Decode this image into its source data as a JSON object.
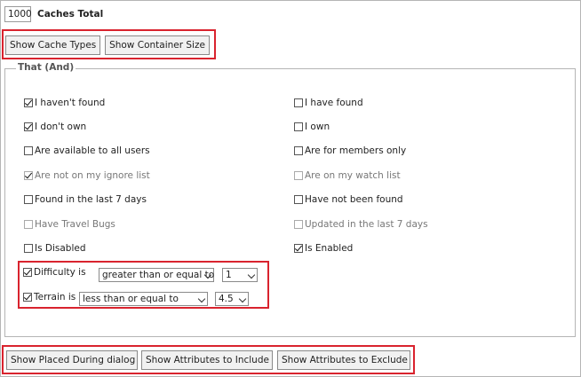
{
  "caches_total": {
    "value": "1000",
    "label": "Caches Total"
  },
  "top_buttons": {
    "show_cache_types": "Show Cache Types",
    "show_container_size": "Show Container Size"
  },
  "filter_group": {
    "legend": "That (And)",
    "left_options": [
      {
        "label": "I haven't found",
        "checked": true,
        "disabled": false
      },
      {
        "label": "I don't own",
        "checked": true,
        "disabled": false
      },
      {
        "label": "Are available to all users",
        "checked": false,
        "disabled": false
      },
      {
        "label": "Are not on my ignore list",
        "checked": true,
        "disabled": true
      },
      {
        "label": "Found in the last 7 days",
        "checked": false,
        "disabled": false
      },
      {
        "label": "Have Travel Bugs",
        "checked": false,
        "disabled": true
      },
      {
        "label": "Is Disabled",
        "checked": false,
        "disabled": false
      }
    ],
    "right_options": [
      {
        "label": "I have found",
        "checked": false,
        "disabled": false
      },
      {
        "label": "I own",
        "checked": false,
        "disabled": false
      },
      {
        "label": "Are for members only",
        "checked": false,
        "disabled": false
      },
      {
        "label": "Are on my watch list",
        "checked": false,
        "disabled": true
      },
      {
        "label": "Have not been found",
        "checked": false,
        "disabled": false
      },
      {
        "label": "Updated in the last 7 days",
        "checked": false,
        "disabled": true
      },
      {
        "label": "Is Enabled",
        "checked": true,
        "disabled": false
      }
    ],
    "difficulty": {
      "label": "Difficulty is",
      "checked": true,
      "comparator": "greater than or equal to",
      "value": "1"
    },
    "terrain": {
      "label": "Terrain is",
      "checked": true,
      "comparator": "less than or equal to",
      "value": "4.5"
    }
  },
  "bottom_buttons": {
    "show_placed_during": "Show Placed During dialog",
    "show_attributes_include": "Show Attributes to Include",
    "show_attributes_exclude": "Show Attributes to Exclude"
  },
  "colors": {
    "highlight_border": "#d9232e",
    "button_bg": "#f1f1f1",
    "fieldset_border": "#b5b5b5"
  }
}
